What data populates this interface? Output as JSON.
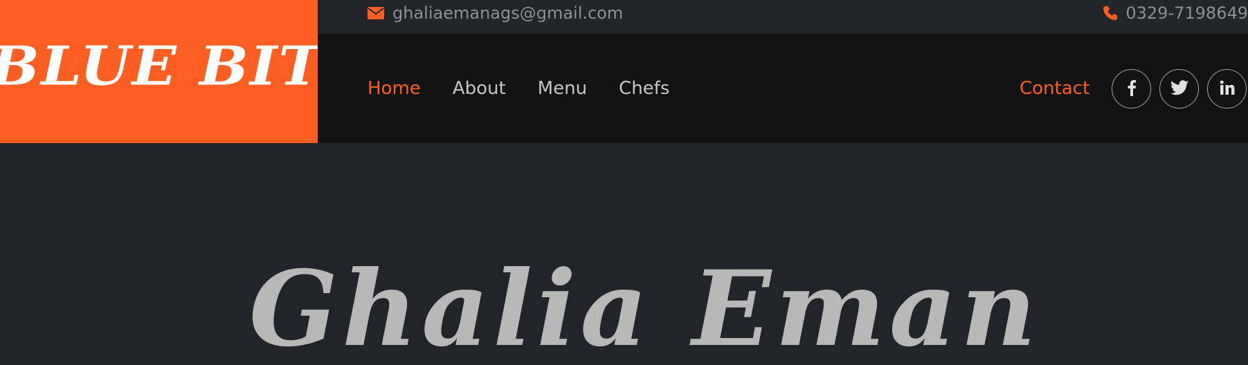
{
  "brand": {
    "logo_text": "BLUE BITE",
    "accent_color": "#fe5e21"
  },
  "topbar": {
    "email": "ghaliaemanags@gmail.com",
    "email_icon": "envelope-icon",
    "phone": "0329-7198649",
    "phone_icon": "phone-icon"
  },
  "nav": {
    "items": [
      {
        "label": "Home",
        "active": true
      },
      {
        "label": "About"
      },
      {
        "label": "Menu"
      },
      {
        "label": "Chefs"
      }
    ],
    "contact_label": "Contact"
  },
  "socials": [
    {
      "icon": "facebook-icon",
      "glyph": "f"
    },
    {
      "icon": "twitter-icon",
      "glyph": "twitter"
    },
    {
      "icon": "linkedin-icon",
      "glyph": "in"
    }
  ],
  "hero": {
    "title": "Ghalia Eman"
  }
}
